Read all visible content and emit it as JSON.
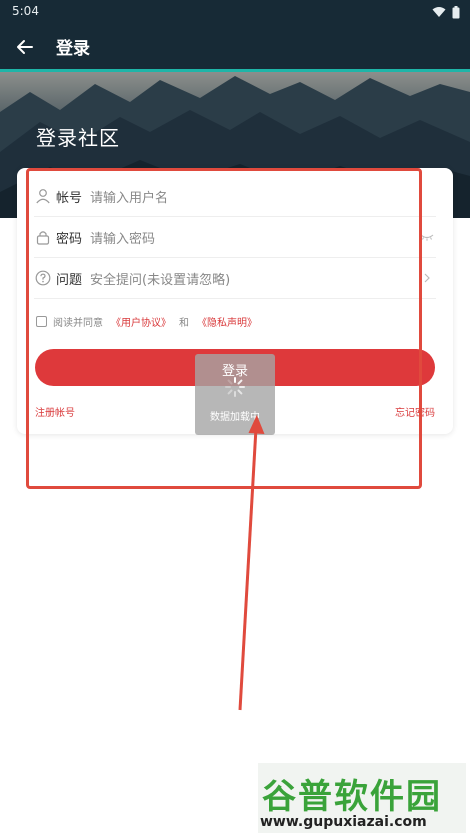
{
  "status_bar": {
    "time": "5:04"
  },
  "app_bar": {
    "title": "登录"
  },
  "hero": {
    "title": "登录社区"
  },
  "form": {
    "username": {
      "label": "帐号",
      "placeholder": "请输入用户名"
    },
    "password": {
      "label": "密码",
      "placeholder": "请输入密码"
    },
    "question": {
      "label": "问题",
      "placeholder": "安全提问(未设置请忽略)"
    },
    "agreement": {
      "prefix": "阅读并同意",
      "user_agreement": "《用户协议》",
      "conjunction": "和",
      "privacy": "《隐私声明》"
    },
    "login_button": "登录",
    "register_link": "注册帐号",
    "forgot_link": "忘记密码"
  },
  "loading": {
    "message": "数据加载中"
  },
  "watermark": {
    "title": "谷普软件园",
    "url": "www.gupuxiazai.com"
  },
  "colors": {
    "header_bg": "#172a36",
    "accent_line": "#1fb5a8",
    "primary_red": "#de393b",
    "annotation": "#e04a3d",
    "watermark_green": "#3aa33a"
  }
}
